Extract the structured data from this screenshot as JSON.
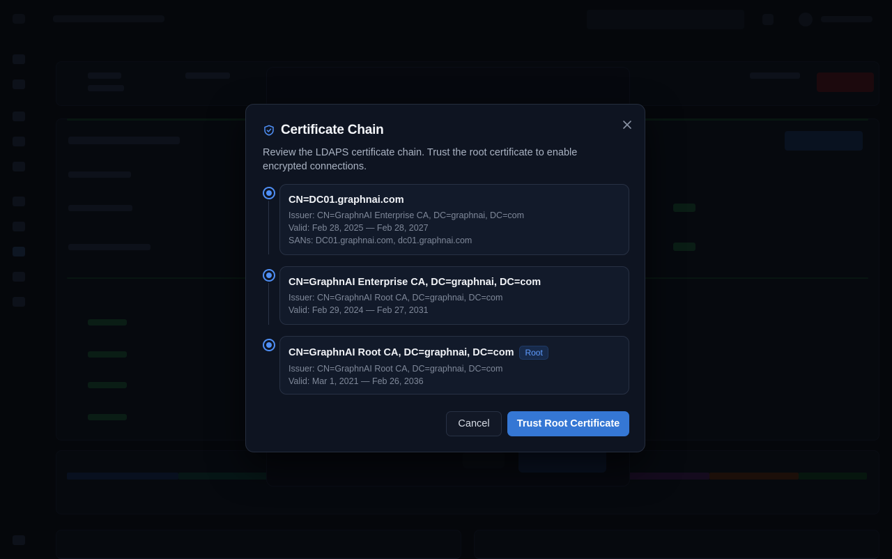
{
  "modal": {
    "title": "Certificate Chain",
    "description": "Review the LDAPS certificate chain. Trust the root certificate to enable encrypted connections.",
    "certificates": [
      {
        "subject": "CN=DC01.graphnai.com",
        "issuer": "Issuer: CN=GraphnAI Enterprise CA, DC=graphnai, DC=com",
        "validity": "Valid: Feb 28, 2025 — Feb 28, 2027",
        "sans": "SANs: DC01.graphnai.com, dc01.graphnai.com"
      },
      {
        "subject": "CN=GraphnAI Enterprise CA, DC=graphnai, DC=com",
        "issuer": "Issuer: CN=GraphnAI Root CA, DC=graphnai, DC=com",
        "validity": "Valid: Feb 29, 2024 — Feb 27, 2031"
      },
      {
        "subject": "CN=GraphnAI Root CA, DC=graphnai, DC=com",
        "badge": "Root",
        "issuer": "Issuer: CN=GraphnAI Root CA, DC=graphnai, DC=com",
        "validity": "Valid: Mar 1, 2021 — Feb 26, 2036"
      }
    ],
    "cancel_label": "Cancel",
    "trust_label": "Trust Root Certificate"
  },
  "colors": {
    "accent": "#3577d4",
    "node": "#4f8ff5",
    "background": "#07090e",
    "modal_bg": "#0e1421"
  },
  "icons": {
    "title_icon": "shield-check-icon",
    "close": "close-icon"
  }
}
